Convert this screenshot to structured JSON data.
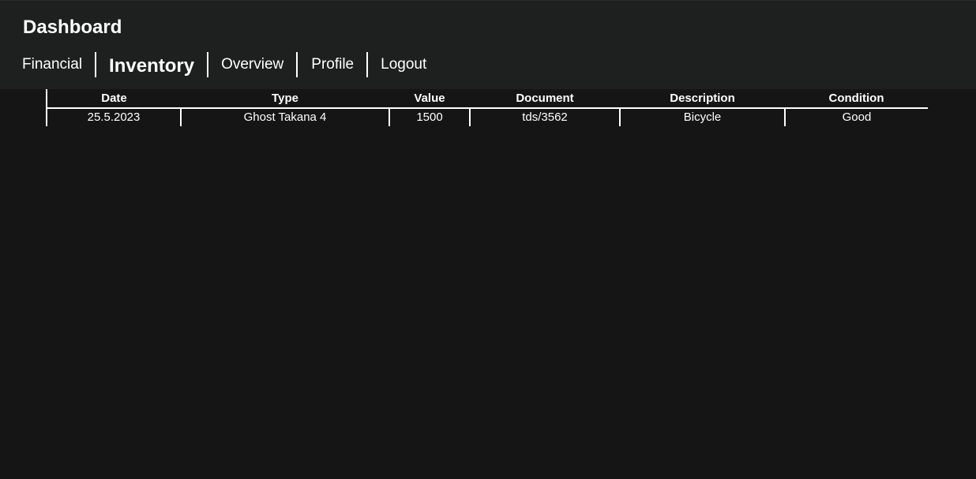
{
  "header": {
    "title": "Dashboard"
  },
  "nav": {
    "items": [
      {
        "label": "Financial",
        "active": false
      },
      {
        "label": "Inventory",
        "active": true
      },
      {
        "label": "Overview",
        "active": false
      },
      {
        "label": "Profile",
        "active": false
      },
      {
        "label": "Logout",
        "active": false
      }
    ]
  },
  "table": {
    "columns": [
      "Date",
      "Type",
      "Value",
      "Document",
      "Description",
      "Condition"
    ],
    "rows": [
      [
        "25.5.2023",
        "Ghost Takana 4",
        "1500",
        "tds/3562",
        "Bicycle",
        "Good"
      ]
    ]
  }
}
